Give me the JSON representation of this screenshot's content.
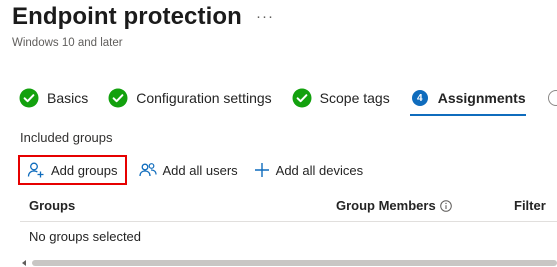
{
  "header": {
    "title": "Endpoint protection",
    "more_label": "···",
    "subtitle": "Windows 10 and later"
  },
  "wizard": {
    "steps": [
      {
        "label": "Basics",
        "state": "complete",
        "icon": "check-circle-icon"
      },
      {
        "label": "Configuration settings",
        "state": "complete",
        "icon": "check-circle-icon"
      },
      {
        "label": "Scope tags",
        "state": "complete",
        "icon": "check-circle-icon"
      },
      {
        "label": "Assignments",
        "state": "active",
        "number": "4"
      },
      {
        "label": "",
        "state": "upcoming"
      }
    ]
  },
  "assignments": {
    "included_groups_label": "Included groups",
    "toolbar": {
      "add_groups": "Add groups",
      "add_all_users": "Add all users",
      "add_all_devices": "Add all devices"
    },
    "table": {
      "columns": [
        "Groups",
        "Group Members",
        "Filter"
      ],
      "empty_text": "No groups selected"
    }
  },
  "colors": {
    "accent": "#0f6cbd",
    "success": "#13a10e",
    "highlight_border": "#e60000"
  }
}
